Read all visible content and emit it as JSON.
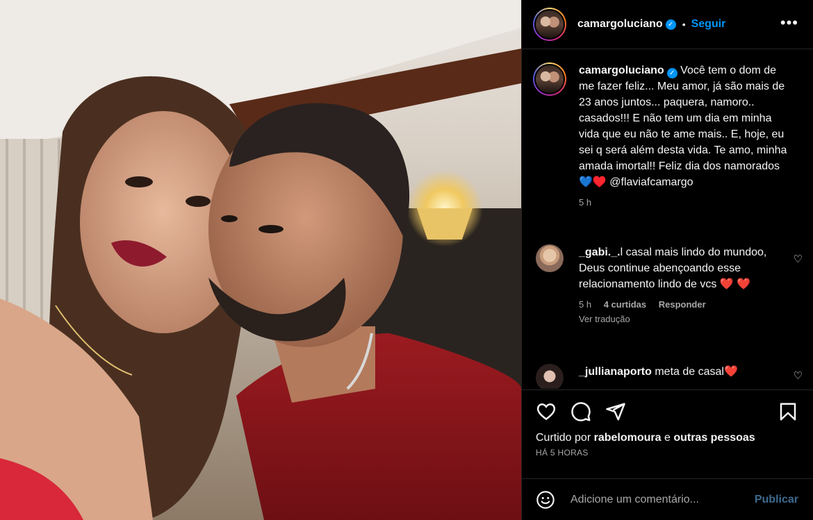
{
  "post": {
    "username": "camargoluciano",
    "follow_label": "Seguir",
    "dot": "•",
    "more_label": "•••"
  },
  "caption": {
    "username": "camargoluciano",
    "text": " Você tem o dom de me fazer feliz... Meu amor, já são mais de 23 anos juntos... paquera, namoro.. casados!!! E não tem um dia em minha vida que eu não te ame mais.. E, hoje, eu sei q será além desta vida. Te amo, minha amada imortal!! Feliz dia dos namorados💙♥️ @flaviafcamargo",
    "time": "5 h"
  },
  "comments": [
    {
      "username": "_gabi._.",
      "text": "l casal mais lindo do mundoo, Deus continue abençoando esse relacionamento lindo de vcs ❤️ ❤️",
      "time": "5 h",
      "likes": "4 curtidas",
      "reply_label": "Responder",
      "translate_label": "Ver tradução"
    },
    {
      "username": "_jullianaporto",
      "text": " meta de casal❤️"
    }
  ],
  "actions": {
    "icons": [
      "heart-icon",
      "comment-icon",
      "share-icon",
      "save-icon"
    ]
  },
  "likes": {
    "prefix": "Curtido por ",
    "user": "rabelomoura",
    "middle": " e ",
    "others": "outras pessoas"
  },
  "timestamp": "HÁ 5 HORAS",
  "comment_box": {
    "placeholder": "Adicione um comentário...",
    "publish_label": "Publicar"
  },
  "colors": {
    "accent": "#0095f6",
    "background": "#000000",
    "secondary_text": "#a8a8a8",
    "publish_disabled": "#3d6a8f"
  }
}
